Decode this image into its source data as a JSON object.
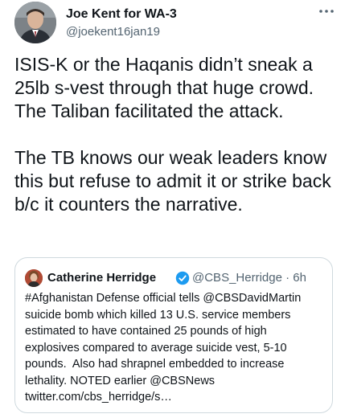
{
  "tweet": {
    "author_name": "Joe Kent for WA-3",
    "author_handle": "@joekent16jan19",
    "more_icon": "more-horizontal-icon",
    "text": "ISIS-K or the Haqanis didn’t sneak a 25lb s-vest through that huge crowd. The Taliban facilitated the attack.\n\nThe TB knows our weak leaders know this but refuse to admit it or strike back b/c it counters the narrative."
  },
  "quoted_tweet": {
    "author_name": "Catherine Herridge",
    "verified_icon": "verified-badge-icon",
    "author_handle": "@CBS_Herridge",
    "separator": "·",
    "time": "6h",
    "text": "#Afghanistan Defense official tells @CBSDavidMartin suicide bomb which killed 13 U.S. service members estimated to have contained 25 pounds of high explosives compared to average suicide vest, 5-10 pounds.  Also had shrapnel embedded to increase lethality. NOTED earlier @CBSNews twitter.com/cbs_herridge/s…"
  },
  "colors": {
    "text": "#0f1419",
    "secondary": "#536471",
    "border": "#cfd9de",
    "verified": "#1d9bf0"
  }
}
